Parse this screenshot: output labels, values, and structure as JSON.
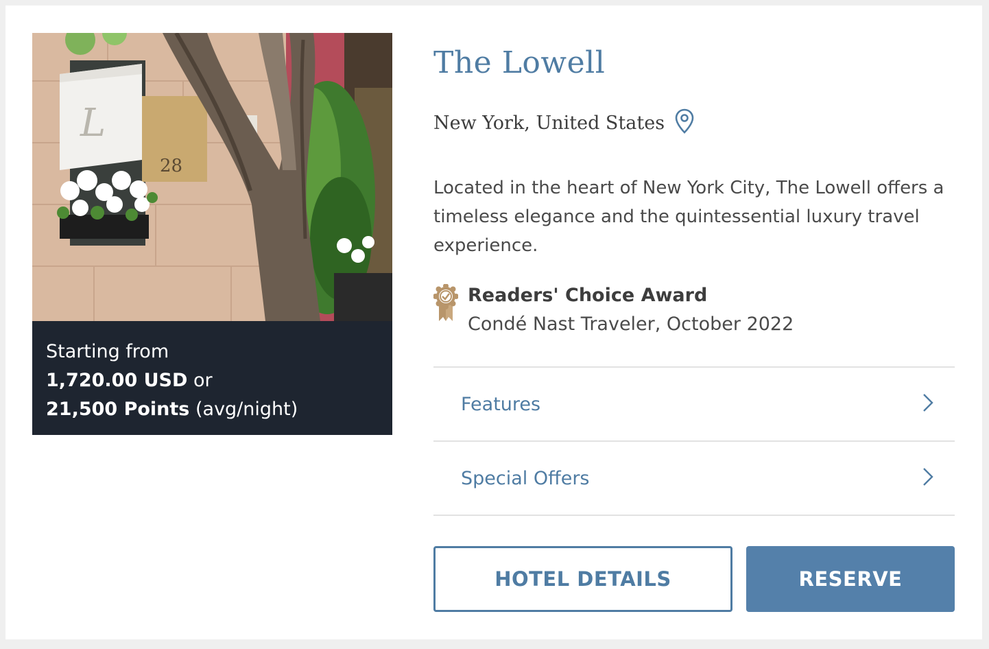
{
  "hotel": {
    "name": "The Lowell",
    "location": "New York, United States",
    "location_icon": "map-pin-icon",
    "description": "Located in the heart of New York City, The Lowell offers a timeless elegance and the quintessential luxury travel experience."
  },
  "photo": {
    "awning_letter": "L",
    "plaque_number": "28"
  },
  "pricing": {
    "starting_label": "Starting from",
    "price": "1,720.00 USD",
    "or_label": "or",
    "points": "21,500 Points",
    "per_night": "(avg/night)"
  },
  "award": {
    "icon": "award-badge-icon",
    "title": "Readers' Choice Award",
    "source": "Condé Nast Traveler, October 2022"
  },
  "accordion": [
    {
      "label": "Features",
      "icon": "chevron-right-icon"
    },
    {
      "label": "Special Offers",
      "icon": "chevron-right-icon"
    }
  ],
  "buttons": {
    "details": "HOTEL DETAILS",
    "reserve": "RESERVE"
  },
  "colors": {
    "accent": "#4f7ca3",
    "reserve_bg": "#5480aa",
    "price_panel_bg": "#1e2530",
    "award_gold": "#b8956a"
  }
}
